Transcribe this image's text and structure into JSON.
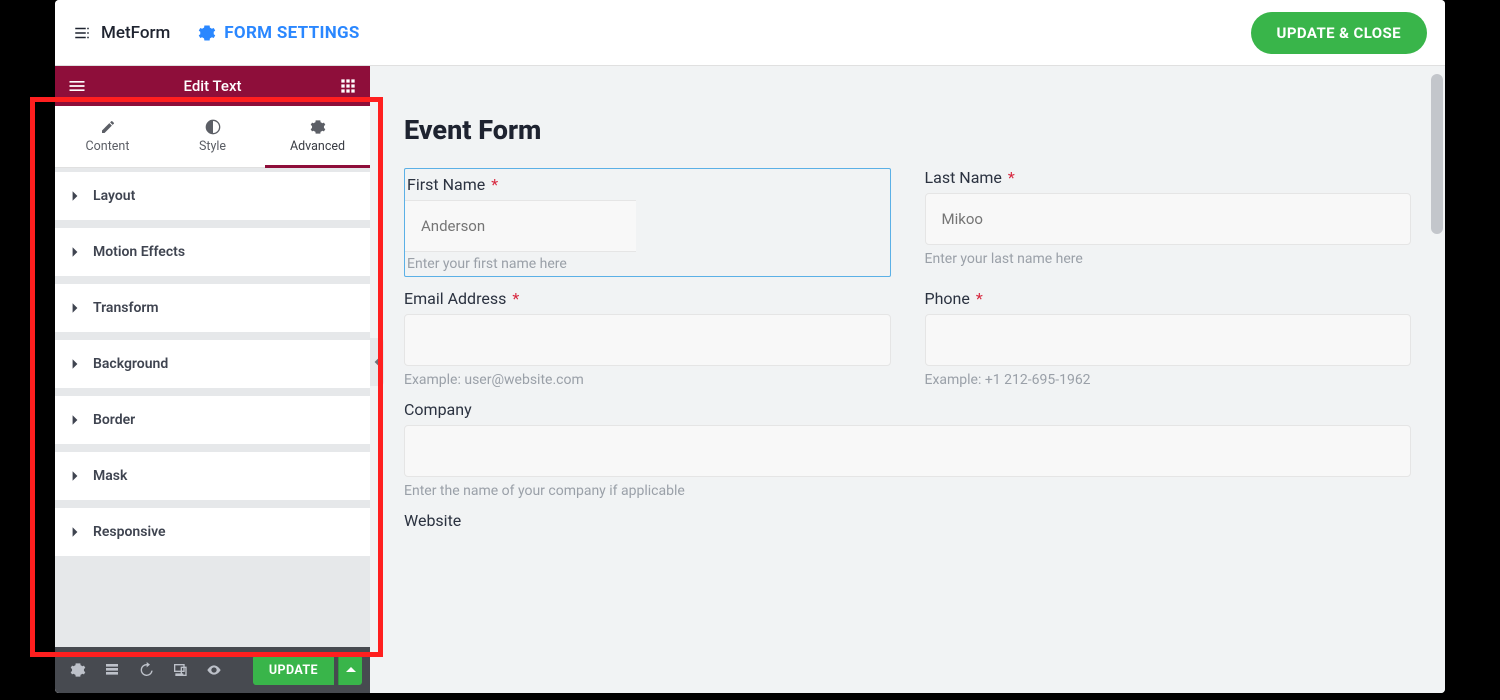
{
  "topbar": {
    "brand": "MetForm",
    "form_settings": "FORM SETTINGS",
    "update_close": "UPDATE & CLOSE"
  },
  "sidebar": {
    "header_title": "Edit Text",
    "tabs": {
      "content": "Content",
      "style": "Style",
      "advanced": "Advanced"
    },
    "sections": [
      "Layout",
      "Motion Effects",
      "Transform",
      "Background",
      "Border",
      "Mask",
      "Responsive"
    ],
    "footer": {
      "update": "UPDATE"
    }
  },
  "form": {
    "title": "Event Form",
    "first_name": {
      "label": "First Name",
      "placeholder": "Anderson",
      "hint": "Enter your first name here"
    },
    "last_name": {
      "label": "Last Name",
      "placeholder": "Mikoo",
      "hint": "Enter your last name here"
    },
    "email": {
      "label": "Email Address",
      "hint": "Example: user@website.com"
    },
    "phone": {
      "label": "Phone",
      "hint": "Example: +1 212-695-1962"
    },
    "company": {
      "label": "Company",
      "hint": "Enter the name of your company if applicable"
    },
    "website": {
      "label": "Website"
    }
  }
}
